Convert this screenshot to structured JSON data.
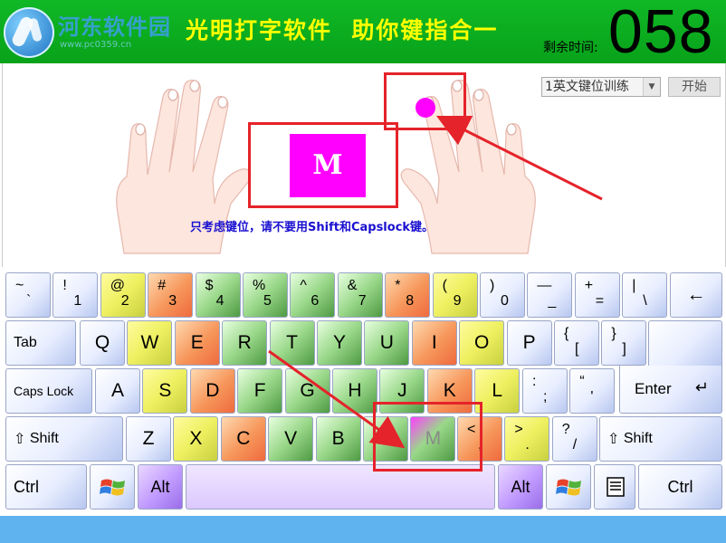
{
  "header": {
    "site_name": "河东软件园",
    "site_url": "www.pc0359.cn",
    "app_title": "光明打字软件  助你键指合一",
    "timer_label": "剩余时间:",
    "timer_value": "058"
  },
  "controls": {
    "mode_value": "1英文键位训练",
    "start_label": "开始"
  },
  "target": {
    "key": "M",
    "hint": "只考虑键位，请不要用Shift和Capslock键。"
  },
  "colors": {
    "header_bg": "#0aa81c",
    "title": "#ffff00",
    "target": "#ff00ff",
    "highlight_box": "#e5232a",
    "status_bar": "#5fb3ee"
  },
  "keyboard": {
    "row1": [
      {
        "top": "~",
        "bottom": "`"
      },
      {
        "top": "!",
        "bottom": "1"
      },
      {
        "top": "@",
        "bottom": "2"
      },
      {
        "top": "#",
        "bottom": "3"
      },
      {
        "top": "$",
        "bottom": "4"
      },
      {
        "top": "%",
        "bottom": "5"
      },
      {
        "top": "^",
        "bottom": "6"
      },
      {
        "top": "&",
        "bottom": "7"
      },
      {
        "top": "*",
        "bottom": "8"
      },
      {
        "top": "(",
        "bottom": "9"
      },
      {
        "top": ")",
        "bottom": "0"
      },
      {
        "top": "—",
        "bottom": "_"
      },
      {
        "top": "+",
        "bottom": "="
      },
      {
        "top": "|",
        "bottom": "\\"
      }
    ],
    "backspace": "←",
    "tab": "Tab",
    "row2": [
      "Q",
      "W",
      "E",
      "R",
      "T",
      "Y",
      "U",
      "I",
      "O",
      "P"
    ],
    "row2_sym": [
      {
        "top": "{",
        "bottom": "["
      },
      {
        "top": "}",
        "bottom": "]"
      }
    ],
    "caps": "Caps Lock",
    "row3": [
      "A",
      "S",
      "D",
      "F",
      "G",
      "H",
      "J",
      "K",
      "L"
    ],
    "row3_sym": [
      {
        "top": ":",
        "bottom": ";"
      },
      {
        "top": "“",
        "bottom": "'"
      }
    ],
    "enter": "Enter",
    "shift_left": "Shift",
    "row4": [
      "Z",
      "X",
      "C",
      "V",
      "B",
      "N",
      "M"
    ],
    "row4_sym": [
      {
        "top": "<",
        "bottom": ","
      },
      {
        "top": ">",
        "bottom": "."
      },
      {
        "top": "?",
        "bottom": "/"
      }
    ],
    "shift_right": "Shift",
    "ctrl_left": "Ctrl",
    "alt_left": "Alt",
    "alt_right": "Alt",
    "ctrl_right": "Ctrl"
  }
}
